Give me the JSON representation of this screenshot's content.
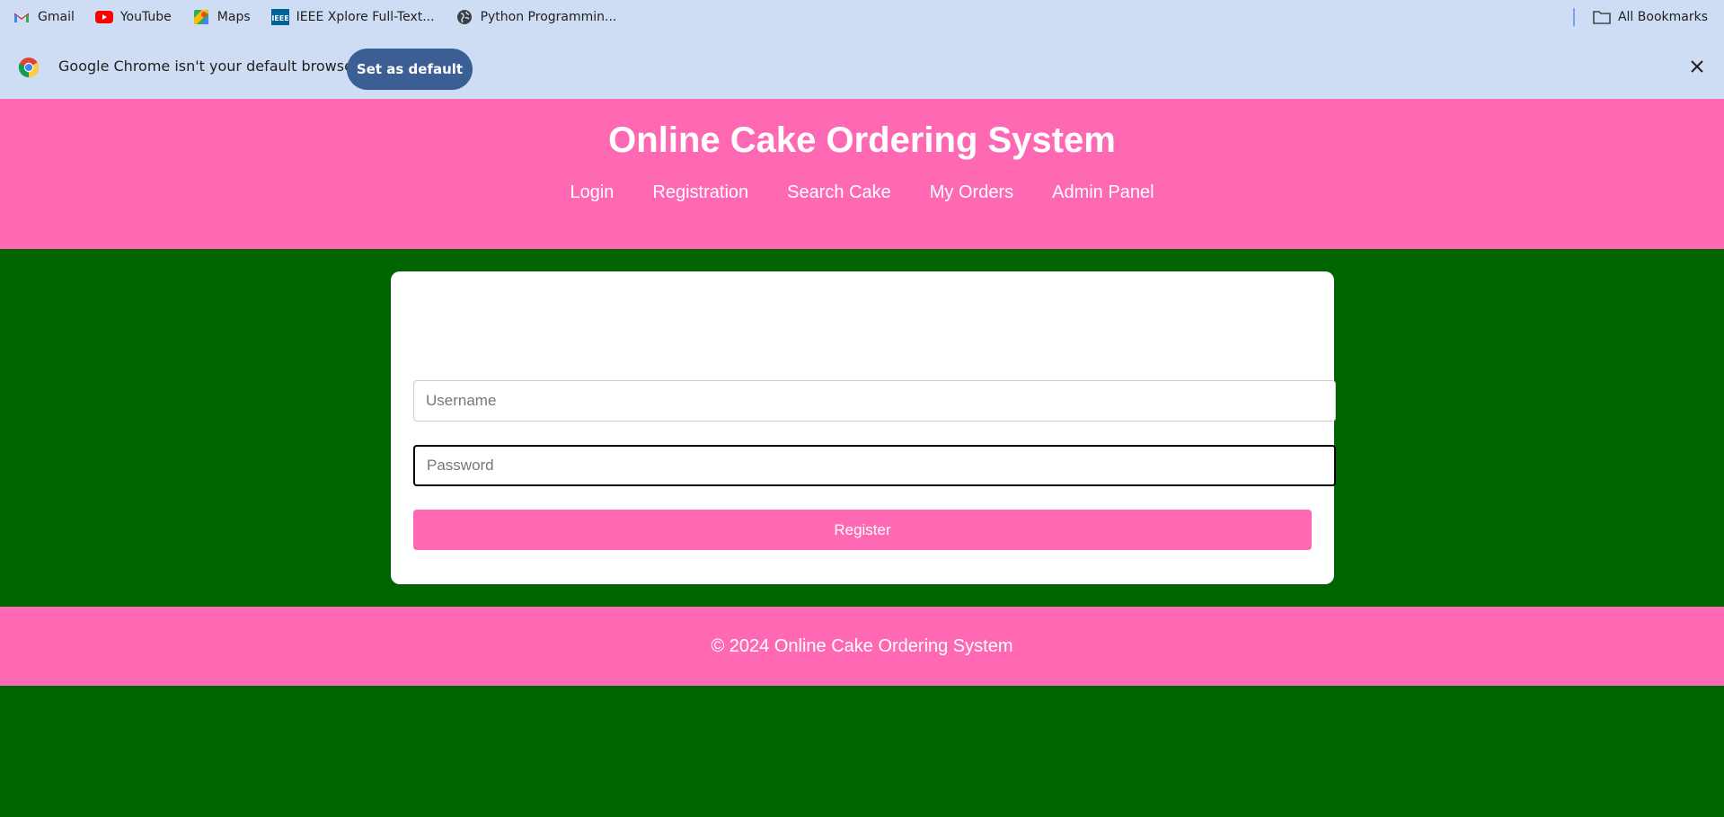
{
  "bookmarks": {
    "items": [
      {
        "label": "Gmail",
        "icon": "gmail-icon"
      },
      {
        "label": "YouTube",
        "icon": "youtube-icon"
      },
      {
        "label": "Maps",
        "icon": "maps-icon"
      },
      {
        "label": "IEEE Xplore Full-Text...",
        "icon": "ieee-icon"
      },
      {
        "label": "Python Programmin...",
        "icon": "globe-icon"
      }
    ],
    "all_bookmarks": "All Bookmarks"
  },
  "infobar": {
    "message": "Google Chrome isn't your default browser",
    "button": "Set as default"
  },
  "header": {
    "title": "Online Cake Ordering System",
    "nav": [
      "Login",
      "Registration",
      "Search Cake",
      "My Orders",
      "Admin Panel"
    ]
  },
  "form": {
    "username_placeholder": "Username",
    "password_placeholder": "Password",
    "submit_label": "Register"
  },
  "footer": {
    "text": "© 2024 Online Cake Ordering System"
  },
  "colors": {
    "page_bg": "#006400",
    "brand_pink": "#ff69b4",
    "chrome_bar": "#cfddf4",
    "set_default_button": "#3b5f94"
  }
}
